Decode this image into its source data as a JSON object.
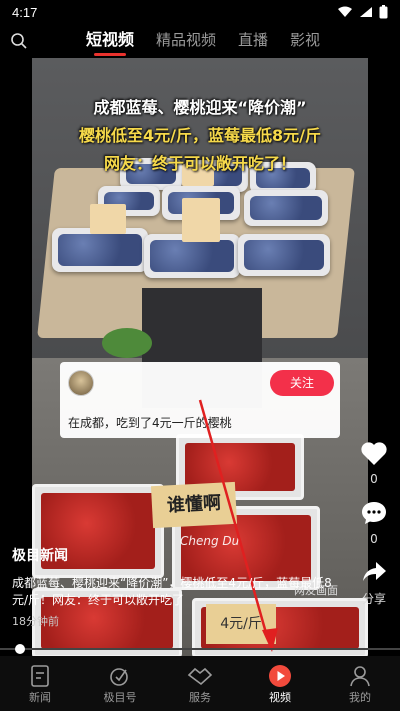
{
  "status": {
    "time": "4:17"
  },
  "nav": {
    "tabs": [
      {
        "label": "短视频"
      },
      {
        "label": "精品视频"
      },
      {
        "label": "直播"
      },
      {
        "label": "影视"
      }
    ]
  },
  "video": {
    "headline": [
      "成都蓝莓、樱桃迎来“降价潮”",
      "樱桃低至4元/斤，蓝莓最低8元/斤",
      "网友：终于可以敞开吃了！"
    ],
    "price_card_1": "",
    "sign_who": "谁懂啊",
    "sign_price": "4元/斤",
    "watermark": "Cheng Du",
    "source_text": "网友画面"
  },
  "overlay_card": {
    "follow_label": "关注",
    "text": "在成都，吃到了4元一斤的樱桃"
  },
  "side_actions": {
    "like_count": "0",
    "comment_count": "0",
    "share_label": "分享"
  },
  "caption": {
    "author": "极目新闻",
    "description": "成都蓝莓、樱桃迎来“降价潮”，樱桃低至4元/斤，蓝莓最低8元/斤！网友：终于可以敞开吃了",
    "time": "18分钟前"
  },
  "playback": {
    "progress": 0.05
  },
  "bottom_nav": {
    "items": [
      {
        "label": "新闻"
      },
      {
        "label": "极目号"
      },
      {
        "label": "服务"
      },
      {
        "label": "视频"
      },
      {
        "label": "我的"
      }
    ]
  },
  "colors": {
    "accent": "#e9322d",
    "follow": "#f3304a",
    "headline_yellow": "#f6d94a"
  }
}
